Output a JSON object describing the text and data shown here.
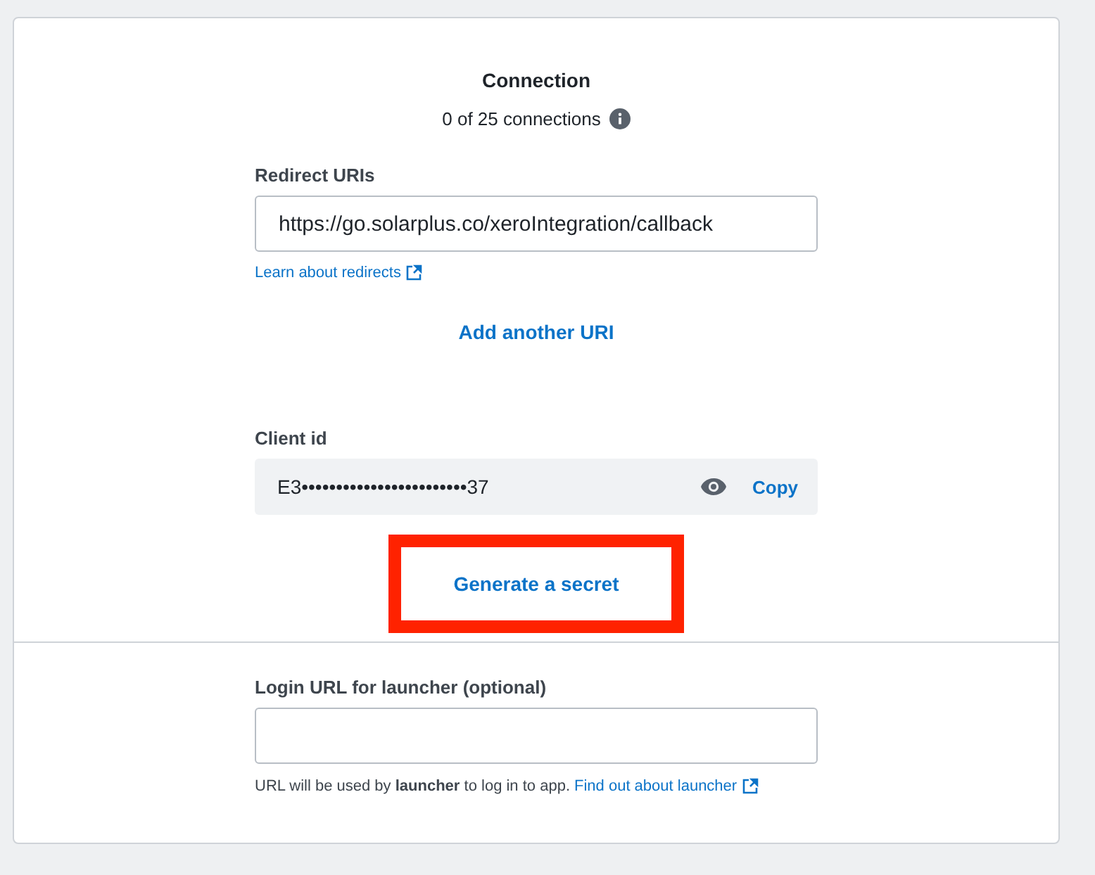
{
  "connection": {
    "title": "Connection",
    "count": "0 of 25 connections"
  },
  "redirect": {
    "label": "Redirect URIs",
    "value": "https://go.solarplus.co/xeroIntegration/callback",
    "link": "Learn about redirects",
    "add_button": "Add another URI"
  },
  "client": {
    "label": "Client id",
    "value": "E3••••••••••••••••••••••••37",
    "copy_button": "Copy"
  },
  "generate_button": {
    "label": "Generate a secret",
    "highlighted": true
  },
  "login": {
    "label": "Login URL for launcher (optional)",
    "help": "URL will be used by **launcher** to log in to app.",
    "link": "Find out about launcher"
  }
}
